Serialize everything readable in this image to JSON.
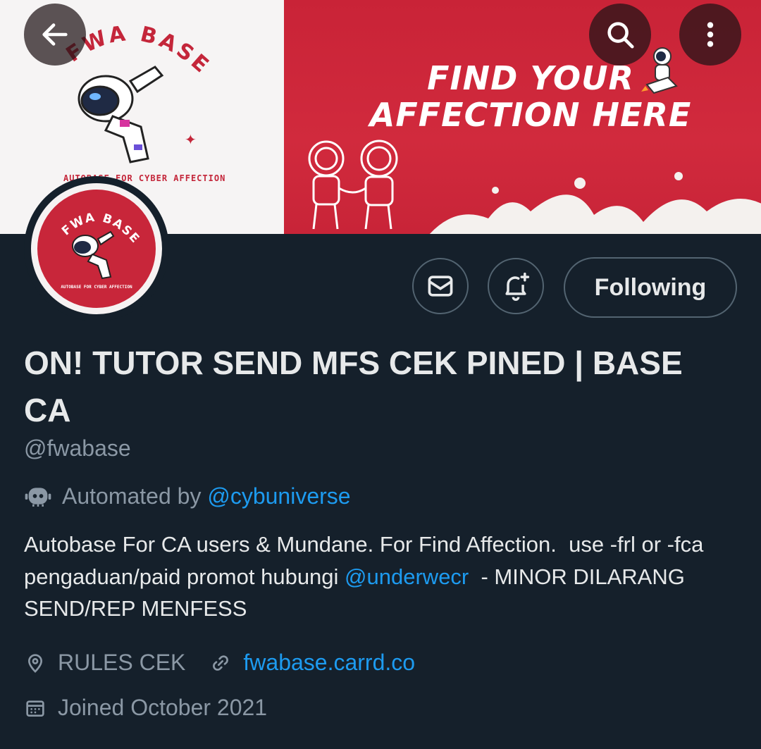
{
  "banner": {
    "left_logo_text": "FWA BASE",
    "left_sub_text": "AUTOBASE FOR CYBER AFFECTION",
    "headline_line1": "FIND YOUR",
    "headline_line2": "AFFECTION HERE",
    "accent_red": "#c92337"
  },
  "top_bar": {
    "back_icon": "arrow-left-icon",
    "search_icon": "search-icon",
    "more_icon": "more-vertical-icon"
  },
  "avatar": {
    "logo_text": "FWA BASE",
    "sub_text": "AUTOBASE FOR CYBER AFFECTION"
  },
  "actions": {
    "message_icon": "envelope-icon",
    "notify_icon": "bell-plus-icon",
    "follow_label": "Following"
  },
  "profile": {
    "display_name": "ON! TUTOR SEND MFS CEK PINED | BASE CA",
    "handle": "@fwabase",
    "automated_prefix": "Automated by ",
    "automated_by": "@cybuniverse",
    "bio_part1": "Autobase For CA users & Mundane. For Find Affection.  use -frl or -fca pengaduan/paid promot hubungi ",
    "bio_mention": "@underwecr",
    "bio_part2": "  - MINOR DILARANG SEND/REP MENFESS",
    "location": "RULES CEK",
    "website": "fwabase.carrd.co",
    "joined": "Joined October 2021"
  },
  "colors": {
    "background": "#15202b",
    "text": "#e7e9ea",
    "muted": "#8b98a5",
    "link": "#1d9bf0",
    "border": "#536471"
  }
}
